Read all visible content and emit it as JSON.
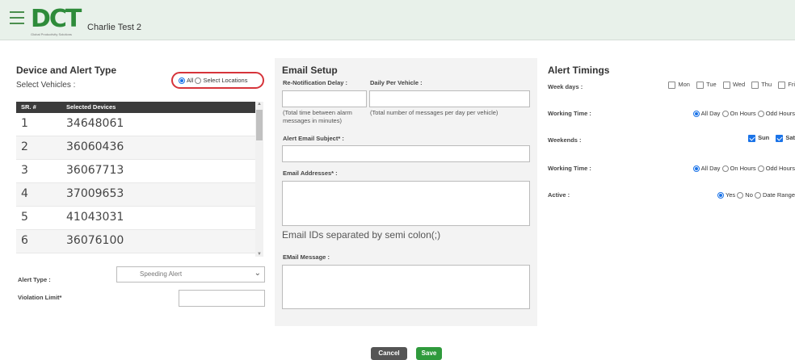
{
  "header": {
    "logo_text": "DCT",
    "logo_tagline": "Global Productivity Solutions",
    "user_name": "Charlie Test 2"
  },
  "device": {
    "title": "Device and Alert Type",
    "select_label": "Select Vehicles :",
    "radio_all": "All",
    "radio_locations": "Select Locations",
    "columns": [
      "SR. #",
      "Selected Devices"
    ],
    "rows": [
      {
        "sr": "1",
        "device": "34648061"
      },
      {
        "sr": "2",
        "device": "36060436"
      },
      {
        "sr": "3",
        "device": "36067713"
      },
      {
        "sr": "4",
        "device": "37009653"
      },
      {
        "sr": "5",
        "device": "41043031"
      },
      {
        "sr": "6",
        "device": "36076100"
      }
    ],
    "alert_type_label": "Alert Type :",
    "alert_type_value": "Speeding Alert",
    "violation_label": "Violation Limit*"
  },
  "email": {
    "title": "Email Setup",
    "renotify_label": "Re-Notification Delay :",
    "daily_label": "Daily Per Vehicle :",
    "renotify_hint": "(Total time between alarm messages in minutes)",
    "daily_hint": "(Total number of messages per day per vehicle)",
    "subject_label": "Alert Email Subject* :",
    "addresses_label": "Email Addresses* :",
    "addresses_hint": "Email IDs separated by semi colon(;)",
    "message_label": "EMail Message :"
  },
  "timings": {
    "title": "Alert Timings",
    "weekdays_label": "Week days :",
    "weekdays": [
      "Mon",
      "Tue",
      "Wed",
      "Thu",
      "Fri"
    ],
    "working_time_label": "Working Time :",
    "time_options": [
      "All Day",
      "On Hours",
      "Odd Hours"
    ],
    "weekends_label": "Weekends :",
    "weekends": [
      "Sun",
      "Sat"
    ],
    "active_label": "Active :",
    "active_options": [
      "Yes",
      "No",
      "Date Range"
    ]
  },
  "actions": {
    "cancel": "Cancel",
    "save": "Save"
  },
  "colors": {
    "brand_green": "#2e8b3a",
    "header_bg": "#e8f1ea",
    "highlight_red": "#d6343a",
    "radio_blue": "#1a73e8"
  }
}
